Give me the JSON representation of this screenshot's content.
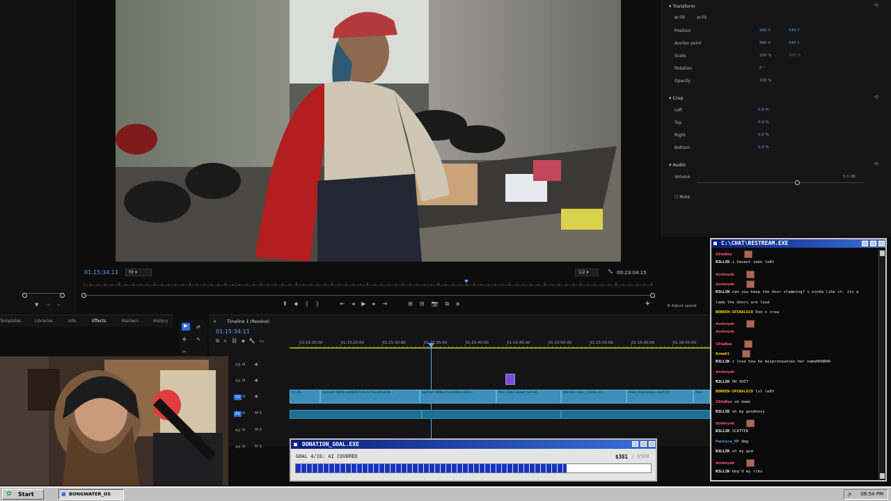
{
  "monitor": {
    "current_timecode": "01:15:34:11",
    "fit_label": "Fit",
    "resolution": "1/2",
    "duration_timecode": "00:23:04:15"
  },
  "effects": {
    "transform": "Transform",
    "fill": "Fill",
    "fit": "Fit",
    "position_label": "Position",
    "position_x": "960 X",
    "position_y": "540 Y",
    "anchor_label": "Anchor point",
    "anchor_x": "960 X",
    "anchor_y": "540 Y",
    "scale_label": "Scale",
    "scale_value": "100 %",
    "scale_value2": "100 %",
    "rotation_label": "Rotation",
    "rotation_value": "0 °",
    "opacity_label": "Opacity",
    "opacity_value": "100 %",
    "crop": "Crop",
    "left_label": "Left",
    "left_value": "0.0 %",
    "top_label": "Top",
    "top_value": "0.0 %",
    "right_label": "Right",
    "right_value": "0.0 %",
    "bottom_label": "Bottom",
    "bottom_value": "0.0 %",
    "audio": "Audio",
    "volume_label": "Volume",
    "volume_value": "0.0 dB",
    "volume_level": 0.6,
    "mute_label": "Mute",
    "adjust_speed": "Adjust speed"
  },
  "panels": {
    "tabs": [
      "Templates",
      "Libraries",
      "Info",
      "Effects",
      "Markers",
      "History"
    ]
  },
  "timeline": {
    "title": "Timeline 1 (Resolve)",
    "timecode": "01:15:34:11",
    "ruler": [
      "01:15:20:00",
      "01:15:25:00",
      "01:15:30:00",
      "01:15:35:00",
      "01:15:40:00",
      "01:15:45:00",
      "01:15:50:00",
      "01:15:55:00",
      "01:16:00:00",
      "01:16:05:00"
    ],
    "tracks": [
      "V3",
      "V2",
      "V1",
      "A1",
      "A2",
      "A3"
    ],
    "clips": [
      "hf_20...",
      "openart-9856ca4db05754a727b1a65a649...",
      "openart-998a572a364bcc2653...",
      "Man_talks_about_tunnel...",
      "Woman_says_i_know_on...",
      "Flow_delpmospu_mp4 [V]",
      "Man..."
    ]
  },
  "chat": {
    "title": "C:\\CHAT\\RESTREAM.EXE",
    "messages": [
      {
        "user": "S04eBee",
        "text": "",
        "color": "#ff5a7a",
        "emote": true
      },
      {
        "user": "R3LLIK",
        "text": "i havent seen le8t",
        "color": "#ffffff",
        "emote": false
      },
      {
        "user": "donkeyak",
        "text": "",
        "color": "#ff5a7a",
        "emote": true
      },
      {
        "user": "donkeyak",
        "text": "",
        "color": "#ff5a7a",
        "emote": true
      },
      {
        "user": "R3LLIK",
        "text": "can you keep the door slamming? i kinda like it. its a",
        "color": "#ffffff",
        "emote": false
      },
      {
        "user": "",
        "text": "lada the doors are loud",
        "color": "#ffffff",
        "emote": false
      },
      {
        "user": "BORKEN-SPIRAL619",
        "text": "Don n crew",
        "color": "#ffd400",
        "emote": false
      },
      {
        "user": "donkeyak",
        "text": "",
        "color": "#ff5a7a",
        "emote": true
      },
      {
        "user": "donkeyak",
        "text": "",
        "color": "#ff5a7a",
        "emote": false
      },
      {
        "user": "S04eBee",
        "text": "",
        "color": "#ff5a7a",
        "emote": true
      },
      {
        "user": "Asmahl",
        "text": "",
        "color": "#ffd400",
        "emote": true
      },
      {
        "user": "R3LLIK",
        "text": "i love how he mispronounces her nameHAHAHA",
        "color": "#ffffff",
        "emote": false
      },
      {
        "user": "donkeyak",
        "text": "",
        "color": "#ff5a7a",
        "emote": false
      },
      {
        "user": "R3LLIK",
        "text": "OH SHIT",
        "color": "#ffffff",
        "emote": false
      },
      {
        "user": "BORKEN-SPIRAL619",
        "text": "lol le8t",
        "color": "#ffd400",
        "emote": false
      },
      {
        "user": "S04eBee",
        "text": "oh damn",
        "color": "#ff5a7a",
        "emote": false
      },
      {
        "user": "R3LLIK",
        "text": "oh my goodness",
        "color": "#ffffff",
        "emote": false
      },
      {
        "user": "donkeyak",
        "text": "",
        "color": "#ff5a7a",
        "emote": true
      },
      {
        "user": "R3LLIK",
        "text": "SCATTER",
        "color": "#ffffff",
        "emote": false
      },
      {
        "user": "Pantera_MP",
        "text": "Omg",
        "color": "#5a9bff",
        "emote": false
      },
      {
        "user": "R3LLIK",
        "text": "oh my god",
        "color": "#ffffff",
        "emote": false
      },
      {
        "user": "donkeyak",
        "text": "",
        "color": "#ff5a7a",
        "emote": true
      },
      {
        "user": "R3LLIK",
        "text": "bbq'd my ribs",
        "color": "#ffffff",
        "emote": false
      }
    ]
  },
  "donation": {
    "title": "DONATION_GOAL.EXE",
    "goal_label": "GOAL 4/10: AI COVERED",
    "amount": "$381",
    "target": "/ $500",
    "progress": 0.762
  },
  "taskbar": {
    "start_label": "Start",
    "task_label": "BONGWATER_OS",
    "clock": "08:54 PM"
  }
}
